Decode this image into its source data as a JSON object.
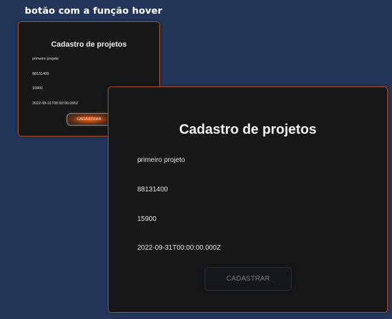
{
  "caption": "botão com a função hover",
  "hover_card": {
    "title": "Cadastro de projetos",
    "fields": [
      "primeiro projeto",
      "88131400",
      "15900",
      "2022-09-31T00:00:00.000Z"
    ],
    "button_label": "CADASTRAR"
  },
  "main_card": {
    "title": "Cadastro de projetos",
    "fields": [
      "primeiro projeto",
      "88131400",
      "15900",
      "2022-09-31T00:00:00.000Z"
    ],
    "button_label": "CADASTRAR"
  },
  "colors": {
    "background": "#233659",
    "card": "#161718",
    "card_border": "#b3542a",
    "hover_glow": "#e2651c"
  }
}
